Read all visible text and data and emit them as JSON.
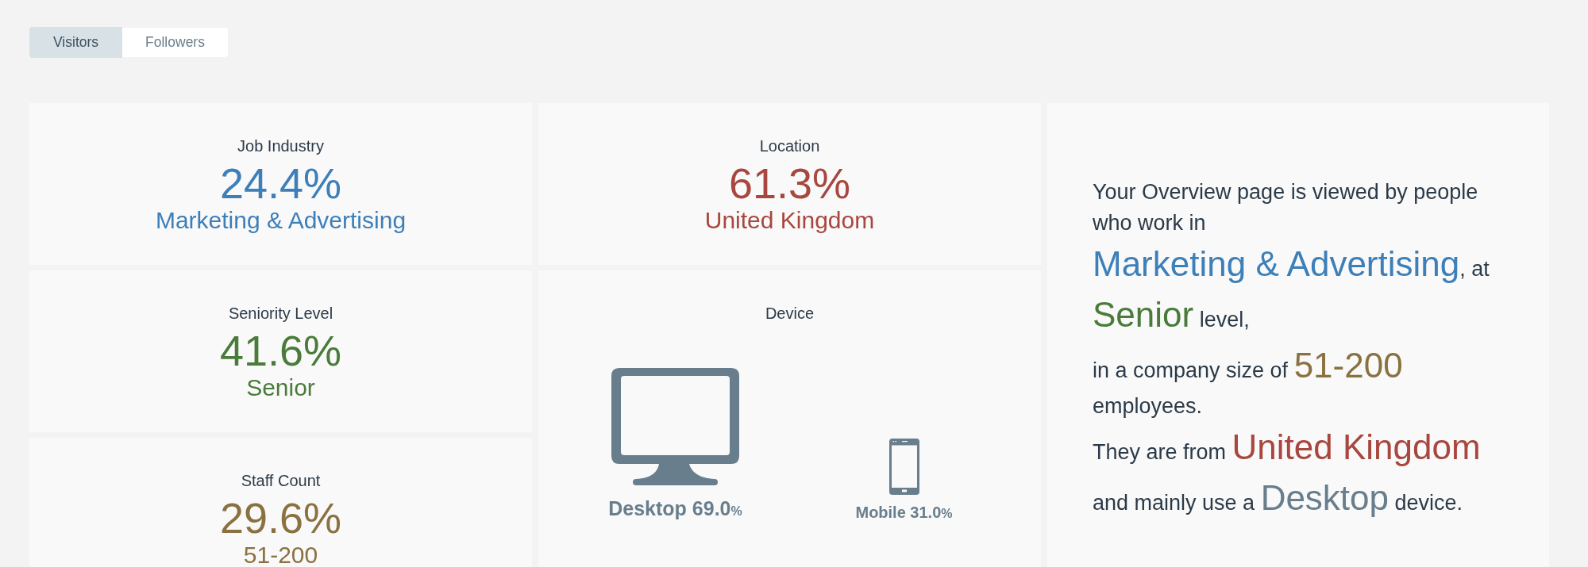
{
  "tabs": [
    {
      "label": "Visitors",
      "selected": true
    },
    {
      "label": "Followers",
      "selected": false
    }
  ],
  "columns": [
    {
      "cards": [
        {
          "kind": "stat",
          "title": "Job Industry",
          "percent": "24.4%",
          "value": "Marketing & Advertising",
          "color": "#3d7fb9"
        },
        {
          "kind": "stat",
          "title": "Seniority Level",
          "percent": "41.6%",
          "value": "Senior",
          "color": "#4a7b3a"
        },
        {
          "kind": "stat",
          "title": "Staff Count",
          "percent": "29.6%",
          "value": "51-200",
          "color": "#8a7140"
        }
      ]
    },
    {
      "cards": [
        {
          "kind": "stat",
          "title": "Location",
          "percent": "61.3%",
          "value": "United Kingdom",
          "color": "#a8473f"
        },
        {
          "kind": "devices",
          "title": "Device",
          "devices": [
            {
              "kind": "desktop",
              "name": "Desktop",
              "share": "69.0",
              "unit": "%"
            },
            {
              "kind": "mobile",
              "name": "Mobile",
              "share": "31.0",
              "unit": "%"
            }
          ]
        }
      ]
    }
  ],
  "summary": {
    "paragraphs": [
      {
        "segments": [
          {
            "kind": "plain",
            "text": "Your Overview page is viewed by people who work in "
          },
          {
            "kind": "highlight",
            "text": "Marketing & Advertising",
            "color": "#3d7fb9"
          },
          {
            "kind": "plain",
            "text": ", at "
          },
          {
            "kind": "highlight",
            "text": "Senior",
            "color": "#4a7b3a"
          },
          {
            "kind": "plain",
            "text": " level,"
          }
        ]
      },
      {
        "segments": [
          {
            "kind": "plain",
            "text": "in a company size of "
          },
          {
            "kind": "highlight",
            "text": "51-200",
            "color": "#8a7140"
          },
          {
            "kind": "plain",
            "text": " employees."
          }
        ]
      },
      {
        "segments": [
          {
            "kind": "plain",
            "text": "They are from "
          },
          {
            "kind": "highlight",
            "text": "United Kingdom",
            "color": "#a8473f"
          },
          {
            "kind": "plain",
            "text": " and mainly use a "
          },
          {
            "kind": "highlight",
            "text": "Desktop",
            "color": "#687e8d"
          },
          {
            "kind": "plain",
            "text": " device."
          }
        ]
      }
    ]
  }
}
